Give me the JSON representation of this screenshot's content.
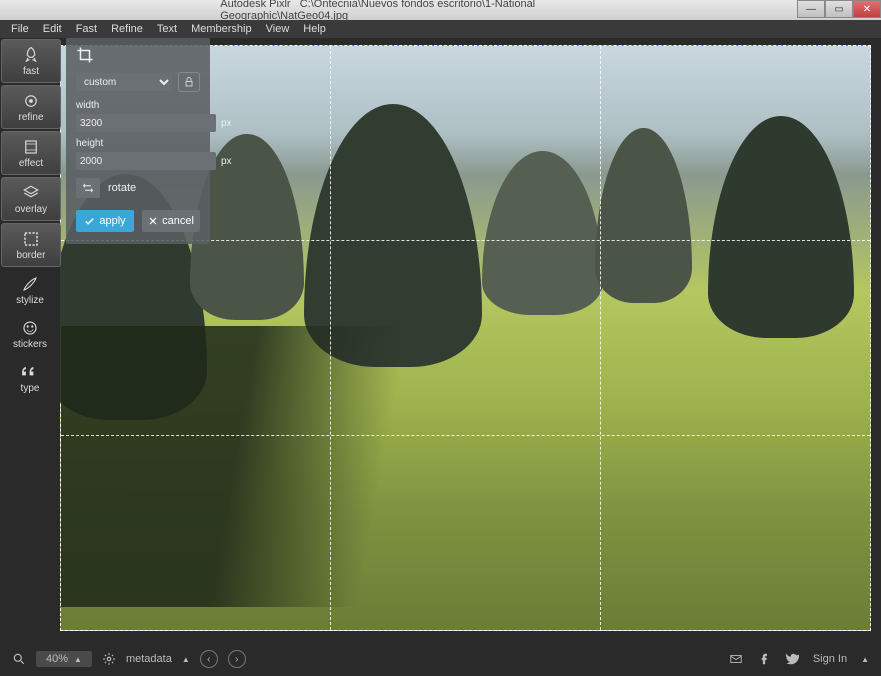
{
  "title_app": "Autodesk Pixlr",
  "title_path": "C:\\Ontecnia\\Nuevos fondos escritorio\\1-National Geographic\\NatGeo04.jpg",
  "menu": [
    "File",
    "Edit",
    "Fast",
    "Refine",
    "Text",
    "Membership",
    "View",
    "Help"
  ],
  "tools": [
    {
      "id": "fast",
      "label": "fast",
      "boxed": true
    },
    {
      "id": "refine",
      "label": "refine",
      "boxed": true
    },
    {
      "id": "effect",
      "label": "effect",
      "boxed": true
    },
    {
      "id": "overlay",
      "label": "overlay",
      "boxed": true
    },
    {
      "id": "border",
      "label": "border",
      "boxed": true
    },
    {
      "id": "stylize",
      "label": "stylize",
      "boxed": false
    },
    {
      "id": "stickers",
      "label": "stickers",
      "boxed": false
    },
    {
      "id": "type",
      "label": "type",
      "boxed": false
    }
  ],
  "crop": {
    "ratio": "custom",
    "width_label": "width",
    "width": "3200",
    "height_label": "height",
    "height": "2000",
    "unit": "px",
    "rotate_label": "rotate",
    "apply": "apply",
    "cancel": "cancel"
  },
  "status": {
    "zoom": "40%",
    "metadata": "metadata",
    "signin": "Sign In"
  }
}
